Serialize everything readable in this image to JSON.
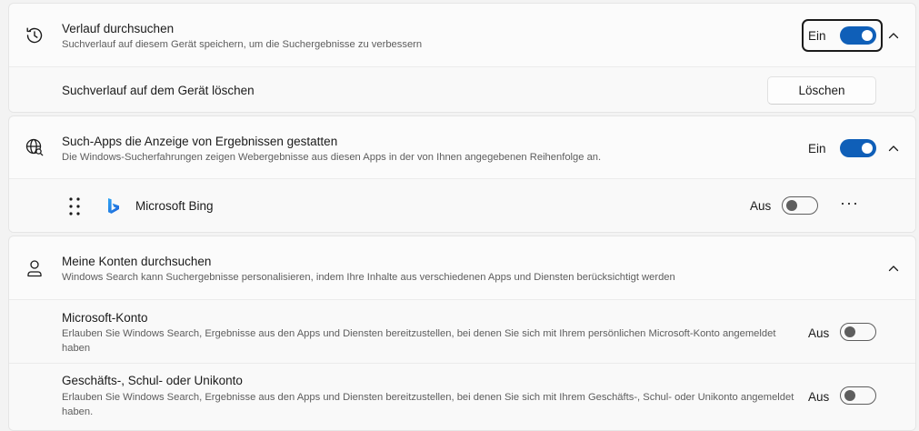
{
  "history": {
    "title": "Verlauf durchsuchen",
    "description": "Suchverlauf auf diesem Gerät speichern, um die Suchergebnisse zu verbessern",
    "state_label": "Ein",
    "toggle_on": true,
    "icon": "history-icon",
    "clear": {
      "title": "Suchverlauf auf dem Gerät löschen",
      "button_label": "Löschen"
    }
  },
  "search_apps": {
    "title": "Such-Apps die Anzeige von Ergebnissen gestatten",
    "description": "Die Windows-Sucherfahrungen zeigen Webergebnisse aus diesen Apps in der von Ihnen angegebenen Reihenfolge an.",
    "state_label": "Ein",
    "toggle_on": true,
    "icon": "globe-search-icon",
    "apps": [
      {
        "name": "Microsoft Bing",
        "state_label": "Aus",
        "toggle_on": false,
        "icon": "bing-icon",
        "more_label": "···"
      }
    ]
  },
  "accounts": {
    "title": "Meine Konten durchsuchen",
    "description": "Windows Search kann Suchergebnisse personalisieren, indem Ihre Inhalte aus verschiedenen Apps und Diensten berücksichtigt werden",
    "icon": "person-icon",
    "items": [
      {
        "title": "Microsoft-Konto",
        "description": "Erlauben Sie Windows Search, Ergebnisse aus den Apps und Diensten bereitzustellen, bei denen Sie sich mit Ihrem persönlichen Microsoft-Konto angemeldet haben",
        "state_label": "Aus",
        "toggle_on": false
      },
      {
        "title": "Geschäfts-, Schul- oder Unikonto",
        "description": "Erlauben Sie Windows Search, Ergebnisse aus den Apps und Diensten bereitzustellen, bei denen Sie sich mit Ihrem Geschäfts-, Schul- oder Unikonto angemeldet haben.",
        "state_label": "Aus",
        "toggle_on": false
      }
    ]
  },
  "colors": {
    "accent": "#0f5fb8",
    "toggle_off": "#5e5e5e"
  }
}
